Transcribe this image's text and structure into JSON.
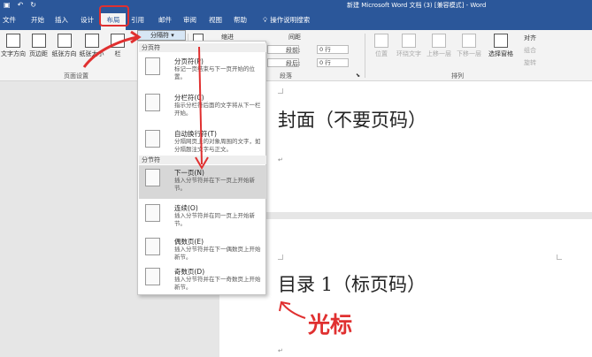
{
  "window": {
    "title": "新建 Microsoft Word 文档 (3) [兼容模式] - Word"
  },
  "tabs": [
    "文件",
    "开始",
    "插入",
    "设计",
    "布局",
    "引用",
    "邮件",
    "审阅",
    "视图",
    "帮助"
  ],
  "active_tab": "布局",
  "tell_me": "操作说明搜索",
  "ribbon": {
    "page_setup": {
      "group_label": "页面设置",
      "buttons": [
        "文字方向",
        "页边距",
        "纸张方向",
        "纸张大小",
        "栏"
      ],
      "breaks_button": "分隔符"
    },
    "paragraph": {
      "indent_label": "缩进",
      "spacing_label": "间距",
      "before_label": "段前:",
      "before_value": "0 行",
      "after_label": "段后:",
      "after_value": "0 行",
      "group_label": "段落"
    },
    "arrange": {
      "group_label": "排列",
      "buttons": [
        "位置",
        "环绕文字",
        "上移一层",
        "下移一层",
        "选择窗格"
      ],
      "side": [
        "对齐",
        "组合",
        "旋转"
      ]
    }
  },
  "breaks_menu": {
    "page_breaks_header": "分页符",
    "section_breaks_header": "分节符",
    "items": [
      {
        "title": "分页符(P)",
        "desc": "标记一页结束与下一页开始的位置。"
      },
      {
        "title": "分栏符(C)",
        "desc": "指示分栏符后面的文字将从下一栏开始。"
      },
      {
        "title": "自动换行符(T)",
        "desc": "分隔网页上的对象周围的文字，如分隔题注文字与正文。"
      },
      {
        "title": "下一页(N)",
        "desc": "插入分节符并在下一页上开始新节。"
      },
      {
        "title": "连续(O)",
        "desc": "插入分节符并在同一页上开始新节。"
      },
      {
        "title": "偶数页(E)",
        "desc": "插入分节符并在下一偶数页上开始新节。"
      },
      {
        "title": "奇数页(D)",
        "desc": "插入分节符并在下一奇数页上开始新节。"
      }
    ]
  },
  "document": {
    "page1_heading": "封面（不要页码）",
    "page2_heading": "目录 1（标页码）",
    "annotation": "光标"
  },
  "colors": {
    "accent": "#2b579a",
    "annotation": "#e03030"
  }
}
